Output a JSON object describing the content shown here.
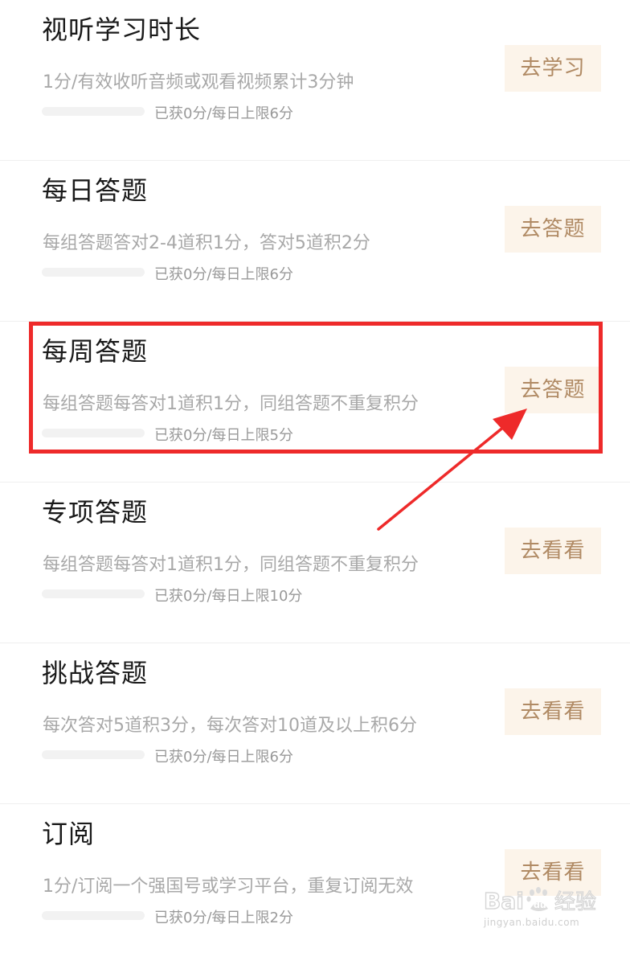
{
  "tasks": [
    {
      "title": "视听学习时长",
      "description": "1分/有效收听音频或观看视频累计3分钟",
      "progress_text": "已获0分/每日上限6分",
      "progress": 0,
      "button_label": "去学习"
    },
    {
      "title": "每日答题",
      "description": "每组答题答对2-4道积1分，答对5道积2分",
      "progress_text": "已获0分/每日上限6分",
      "progress": 0,
      "button_label": "去答题"
    },
    {
      "title": "每周答题",
      "description": "每组答题每答对1道积1分，同组答题不重复积分",
      "progress_text": "已获0分/每日上限5分",
      "progress": 0,
      "button_label": "去答题"
    },
    {
      "title": "专项答题",
      "description": "每组答题每答对1道积1分，同组答题不重复积分",
      "progress_text": "已获0分/每日上限10分",
      "progress": 0,
      "button_label": "去看看"
    },
    {
      "title": "挑战答题",
      "description": "每次答对5道积3分，每次答对10道及以上积6分",
      "progress_text": "已获0分/每日上限6分",
      "progress": 0,
      "button_label": "去看看"
    },
    {
      "title": "订阅",
      "description": "1分/订阅一个强国号或学习平台，重复订阅无效",
      "progress_text": "已获0分/每日上限2分",
      "progress": 0,
      "button_label": "去看看"
    }
  ],
  "annotation": {
    "highlight_color": "#ee2a2a",
    "arrow_color": "#ee2a2a"
  },
  "watermark": {
    "logo_text": "Bai du 经验",
    "domain": "jingyan.baidu.com"
  },
  "colors": {
    "title": "#1a1a1a",
    "description": "#a8a8a8",
    "button_bg": "#fcf4ea",
    "button_text": "#b08a64"
  }
}
